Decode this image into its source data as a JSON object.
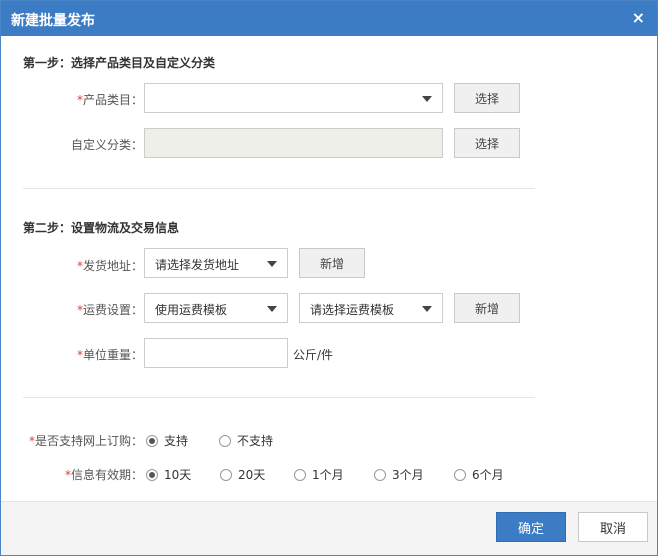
{
  "dialog": {
    "title": "新建批量发布",
    "close_glyph": "×"
  },
  "step1": {
    "title": "第一步：选择产品类目及自定义分类",
    "category_label": "产品类目：",
    "category_value": "",
    "category_button": "选择",
    "custom_label": "自定义分类：",
    "custom_value": "",
    "custom_button": "选择"
  },
  "step2": {
    "title": "第二步：设置物流及交易信息",
    "address_label": "发货地址：",
    "address_value": "请选择发货地址",
    "address_button": "新增",
    "freight_label": "运费设置：",
    "freight_type_value": "使用运费模板",
    "freight_template_value": "请选择运费模板",
    "freight_button": "新增",
    "weight_label": "单位重量：",
    "weight_value": "",
    "weight_unit": "公斤/件"
  },
  "step3": {
    "online_label": "是否支持网上订购：",
    "online_options": [
      {
        "label": "支持",
        "checked": true
      },
      {
        "label": "不支持",
        "checked": false
      }
    ],
    "validity_label": "信息有效期：",
    "validity_options": [
      {
        "label": "10天",
        "checked": true
      },
      {
        "label": "20天",
        "checked": false
      },
      {
        "label": "1个月",
        "checked": false
      },
      {
        "label": "3个月",
        "checked": false
      },
      {
        "label": "6个月",
        "checked": false
      }
    ]
  },
  "footer": {
    "confirm_label": "确定",
    "cancel_label": "取消"
  },
  "required_mark": "*",
  "colors": {
    "accent": "#3c7cc4",
    "required": "#e23b3b"
  }
}
